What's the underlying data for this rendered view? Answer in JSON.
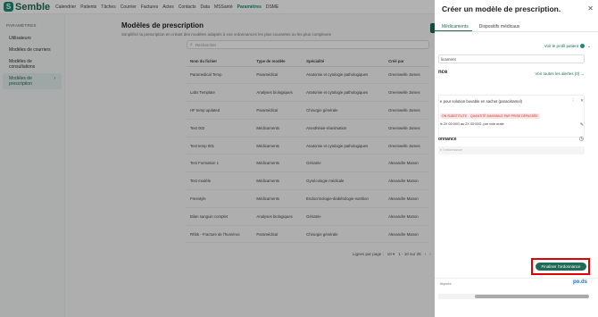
{
  "brand": {
    "name": "Semble",
    "mark": "S"
  },
  "nav": [
    "Calendrier",
    "Patients",
    "Tâches",
    "Courrier",
    "Factures",
    "Actes",
    "Contacts",
    "Data",
    "MSSanté",
    "Paramètres",
    "DSME"
  ],
  "nav_active": "Paramètres",
  "sidebar": {
    "title": "PARAMÈTRES",
    "items": [
      "Utilisateurs",
      "Modèles de courriers",
      "Modèles de consultations",
      "Modèles de prescription"
    ],
    "active_arrow": "›"
  },
  "main": {
    "title": "Modèles de prescription",
    "subtitle": "Simplifiez la prescription en créant des modèles adaptés à vos ordonnances les plus courantes ou les plus complexes",
    "search_placeholder": "Rechercher",
    "columns": [
      "Nom du fichier",
      "Type de modèle",
      "Spécialité",
      "Créé par"
    ],
    "rows": [
      [
        "Paramedical Temp",
        "Paramédical",
        "Anatomie et cytologie pathologiques",
        "Greenwelle James"
      ],
      [
        "Labs Template",
        "Analyses biologiques",
        "Anatomie et cytologie pathologiques",
        "Greenwelle James"
      ],
      [
        "HF temp updated",
        "Paramédical",
        "Chirurgie générale",
        "Greenwelle James"
      ],
      [
        "Test 002",
        "Médicaments",
        "Anesthésie-réanimation",
        "Greenwelle James"
      ],
      [
        "Test temp 001",
        "Médicaments",
        "Anatomie et cytologie pathologiques",
        "Greenwelle James"
      ],
      [
        "Test Formation 1",
        "Médicaments",
        "Gériatrie",
        "Alexandre Manon"
      ],
      [
        "Test modèle",
        "Médicaments",
        "Gynécologie médicale",
        "Alexandre Manon"
      ],
      [
        "Freestyle",
        "Médicaments",
        "Endocrinologie-diabétologie-nutrition",
        "Alexandre Manon"
      ],
      [
        "Bilan sanguin complet",
        "Analyses biologiques",
        "Gériatrie",
        "Alexandre Manon"
      ],
      [
        "Rhbk - Fracture de l'humérus",
        "Paramédical",
        "Chirurgie générale",
        "Alexandre Manon"
      ]
    ],
    "pager": {
      "label": "Lignes par page :",
      "per_page": "10",
      "range": "1 - 10 sur 28"
    }
  },
  "drawer": {
    "title": "Créer un modèle de prescription.",
    "tabs": [
      "Médicaments",
      "Dispositifs médicaux"
    ],
    "profile_link": "Voir le profil patient",
    "med_input": "licament",
    "alerts_title": "nce",
    "alerts_link": "Voir toutes les alertes (0)",
    "drug_name": "e pour solution buvable en sachet (paracétamol)",
    "tag1": "ON SUBSTITUTE",
    "tag2": "QUANTITÉ MAXIMALE PAR PRISE DÉPASSÉE",
    "posology": "is 2X 00:00G au 2X 00:00G, par voie orale",
    "duration_label": "onnance",
    "duration_placeholder": "e l'ordonnance",
    "finalize": "Finaliser l'ordonnance",
    "footer_left": "lispnée",
    "footer_logo": "po.ds"
  },
  "colors": {
    "accent": "#1f6b55",
    "highlight": "#e00000"
  }
}
